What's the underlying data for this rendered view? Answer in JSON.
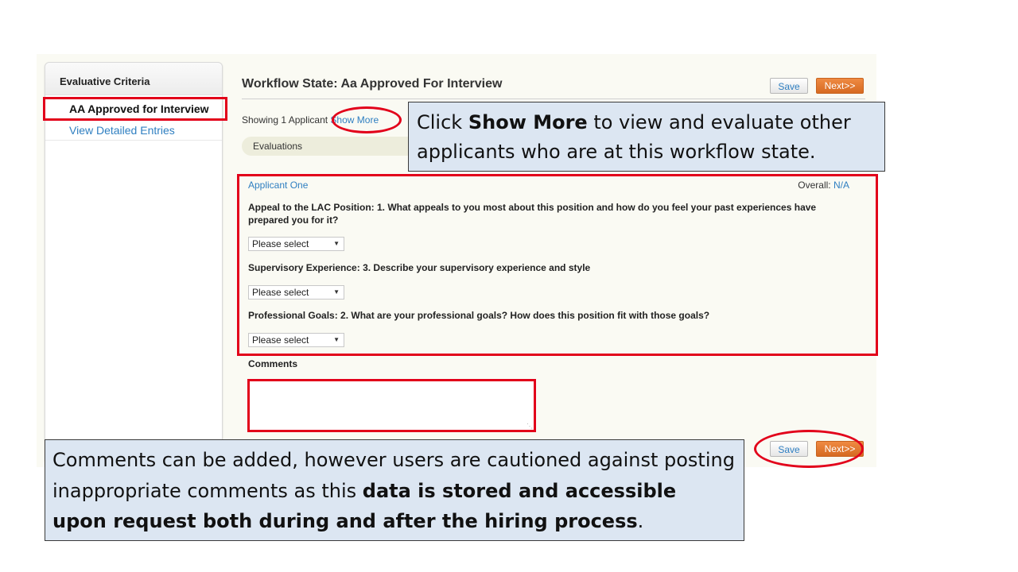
{
  "sidebar": {
    "title": "Evaluative Criteria",
    "items": [
      {
        "label": "AA Approved for Interview",
        "active": true
      },
      {
        "label": "View Detailed Entries",
        "active": false
      }
    ]
  },
  "header": {
    "title": "Workflow State: Aa Approved For Interview",
    "save_label": "Save",
    "next_label": "Next>>"
  },
  "showing": {
    "text": "Showing 1 Applicant",
    "show_more_label": "Show More"
  },
  "tabs": {
    "evaluations_label": "Evaluations"
  },
  "applicant": {
    "name": "Applicant One",
    "overall_label": "Overall:",
    "overall_value": "N/A"
  },
  "questions": [
    {
      "text": "Appeal to the LAC Position: 1. What appeals to you most about this position and how do you feel your past experiences have prepared you for it?",
      "selected": "Please select"
    },
    {
      "text": "Supervisory Experience: 3. Describe your supervisory experience and style",
      "selected": "Please select"
    },
    {
      "text": "Professional Goals: 2. What are your professional goals? How does this position fit with those goals?",
      "selected": "Please select"
    }
  ],
  "comments": {
    "label": "Comments",
    "value": ""
  },
  "footer": {
    "save_label": "Save",
    "next_label": "Next>>"
  },
  "callouts": {
    "show_more": {
      "pre": "Click ",
      "bold": "Show More",
      "post": " to view and evaluate other applicants who are at this workflow state."
    },
    "comments": {
      "pre": "Comments can be added, however users are cautioned against posting inappropriate comments as this ",
      "bold": "data is stored and accessible upon request both during and after the hiring process",
      "post": "."
    }
  },
  "colors": {
    "link": "#2f7fc1",
    "next_button": "#e07a30",
    "highlight": "#e2001a",
    "callout_bg": "#dce6f2",
    "eval_tab": "#ededdc"
  },
  "icons": {
    "dropdown": "chevron-down-icon",
    "textarea_grip": "resize-grip-icon"
  }
}
